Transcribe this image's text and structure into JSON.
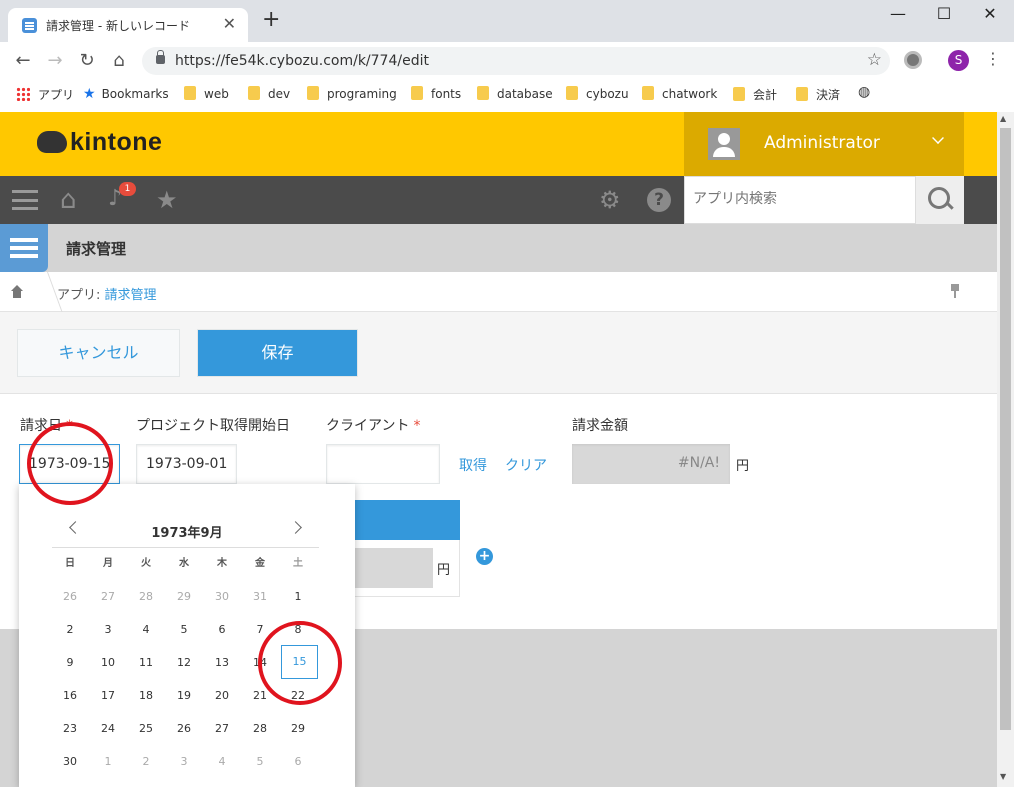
{
  "browser": {
    "tab_title": "請求管理 - 新しいレコード",
    "tab_close": "✕",
    "new_tab": "+",
    "window_minimize": "—",
    "window_maximize": "☐",
    "window_close": "✕",
    "url": "https://fe54k.cybozu.com/k/774/edit",
    "profile_initial": "S",
    "bookmarks": [
      {
        "label": "アプリ",
        "icon": "apps-grid-icon"
      },
      {
        "label": "Bookmarks",
        "icon": "star-icon"
      },
      {
        "label": "web",
        "icon": "folder-icon"
      },
      {
        "label": "dev",
        "icon": "folder-icon"
      },
      {
        "label": "programing",
        "icon": "folder-icon"
      },
      {
        "label": "fonts",
        "icon": "folder-icon"
      },
      {
        "label": "database",
        "icon": "folder-icon"
      },
      {
        "label": "cybozu",
        "icon": "folder-icon"
      },
      {
        "label": "chatwork",
        "icon": "folder-icon"
      },
      {
        "label": "会計",
        "icon": "folder-icon"
      },
      {
        "label": "決済",
        "icon": "folder-icon"
      }
    ]
  },
  "kintone": {
    "logo": "kintone",
    "user_name": "Administrator",
    "notification_count": "1",
    "search_placeholder": "アプリ内検索",
    "app_title": "請求管理",
    "breadcrumb_prefix": "アプリ: ",
    "breadcrumb_app": "請求管理",
    "colors": {
      "header": "#ffc800",
      "user_box": "#dbaa00",
      "accent": "#3498db",
      "required": "#e74c3c"
    }
  },
  "actions": {
    "cancel_label": "キャンセル",
    "save_label": "保存"
  },
  "form": {
    "invoice_date_label": "請求日",
    "invoice_date_value": "1973-09-15",
    "required_mark": "*",
    "project_start_label": "プロジェクト取得開始日",
    "project_start_value": "1973-09-01",
    "client_label": "クライアント",
    "client_value": "",
    "fetch_label": "取得",
    "clear_label": "クリア",
    "amount_label": "請求金額",
    "amount_value": "#N/A!",
    "currency": "円",
    "table_currency": "円",
    "add_row": "+"
  },
  "datepicker": {
    "title": "1973年9月",
    "weekdays": [
      "日",
      "月",
      "火",
      "水",
      "木",
      "金",
      "土"
    ],
    "weeks": [
      [
        "26",
        "27",
        "28",
        "29",
        "30",
        "31",
        "1"
      ],
      [
        "2",
        "3",
        "4",
        "5",
        "6",
        "7",
        "8"
      ],
      [
        "9",
        "10",
        "11",
        "12",
        "13",
        "14",
        "15"
      ],
      [
        "16",
        "17",
        "18",
        "19",
        "20",
        "21",
        "22"
      ],
      [
        "23",
        "24",
        "25",
        "26",
        "27",
        "28",
        "29"
      ],
      [
        "30",
        "1",
        "2",
        "3",
        "4",
        "5",
        "6"
      ]
    ],
    "selected_day": "15"
  }
}
